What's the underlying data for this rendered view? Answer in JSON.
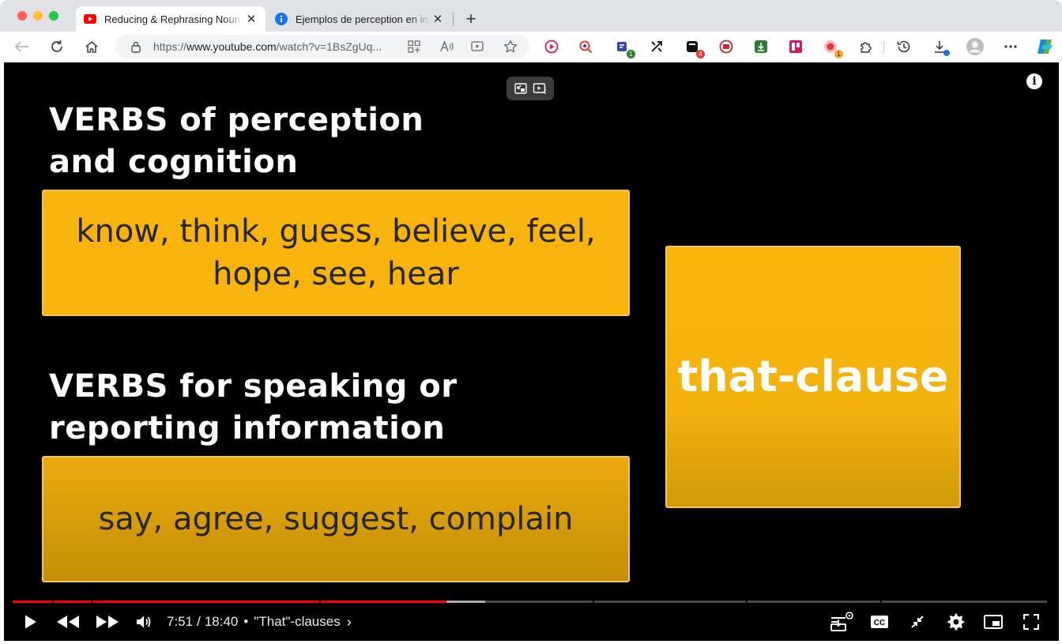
{
  "browser": {
    "tabs": [
      {
        "title": "Reducing & Rephrasing Noun C",
        "favicon": "youtube-icon",
        "active": true
      },
      {
        "title": "Ejemplos de perception en ingl",
        "favicon": "info-icon",
        "active": false
      }
    ],
    "close_glyph": "✕",
    "new_tab_glyph": "+",
    "url_prefix": "https://",
    "url_host": "www.youtube.com",
    "url_path": "/watch?v=1BsZgUq...",
    "extension_badges": [
      "1",
      "4",
      "1"
    ]
  },
  "slide": {
    "heading1_line1": "VERBS of perception",
    "heading1_line2": "and cognition",
    "box1_line1": "know, think, guess, believe, feel,",
    "box1_line2": "hope, see, hear",
    "heading2_line1": "VERBS for speaking or",
    "heading2_line2": "reporting information",
    "box2": "say, agree, suggest, complain",
    "box3": "that-clause"
  },
  "player": {
    "info_glyph": "i",
    "current_time": "7:51",
    "separator": "/",
    "duration": "18:40",
    "bullet": "•",
    "chapter_title": "\"That\"-clauses",
    "chapter_chevron": "›",
    "progress_fraction": 0.4188,
    "buffered_fraction": 0.4565,
    "colors": {
      "played": "#ff0000",
      "slide_yellow": "#f8b40c"
    }
  }
}
